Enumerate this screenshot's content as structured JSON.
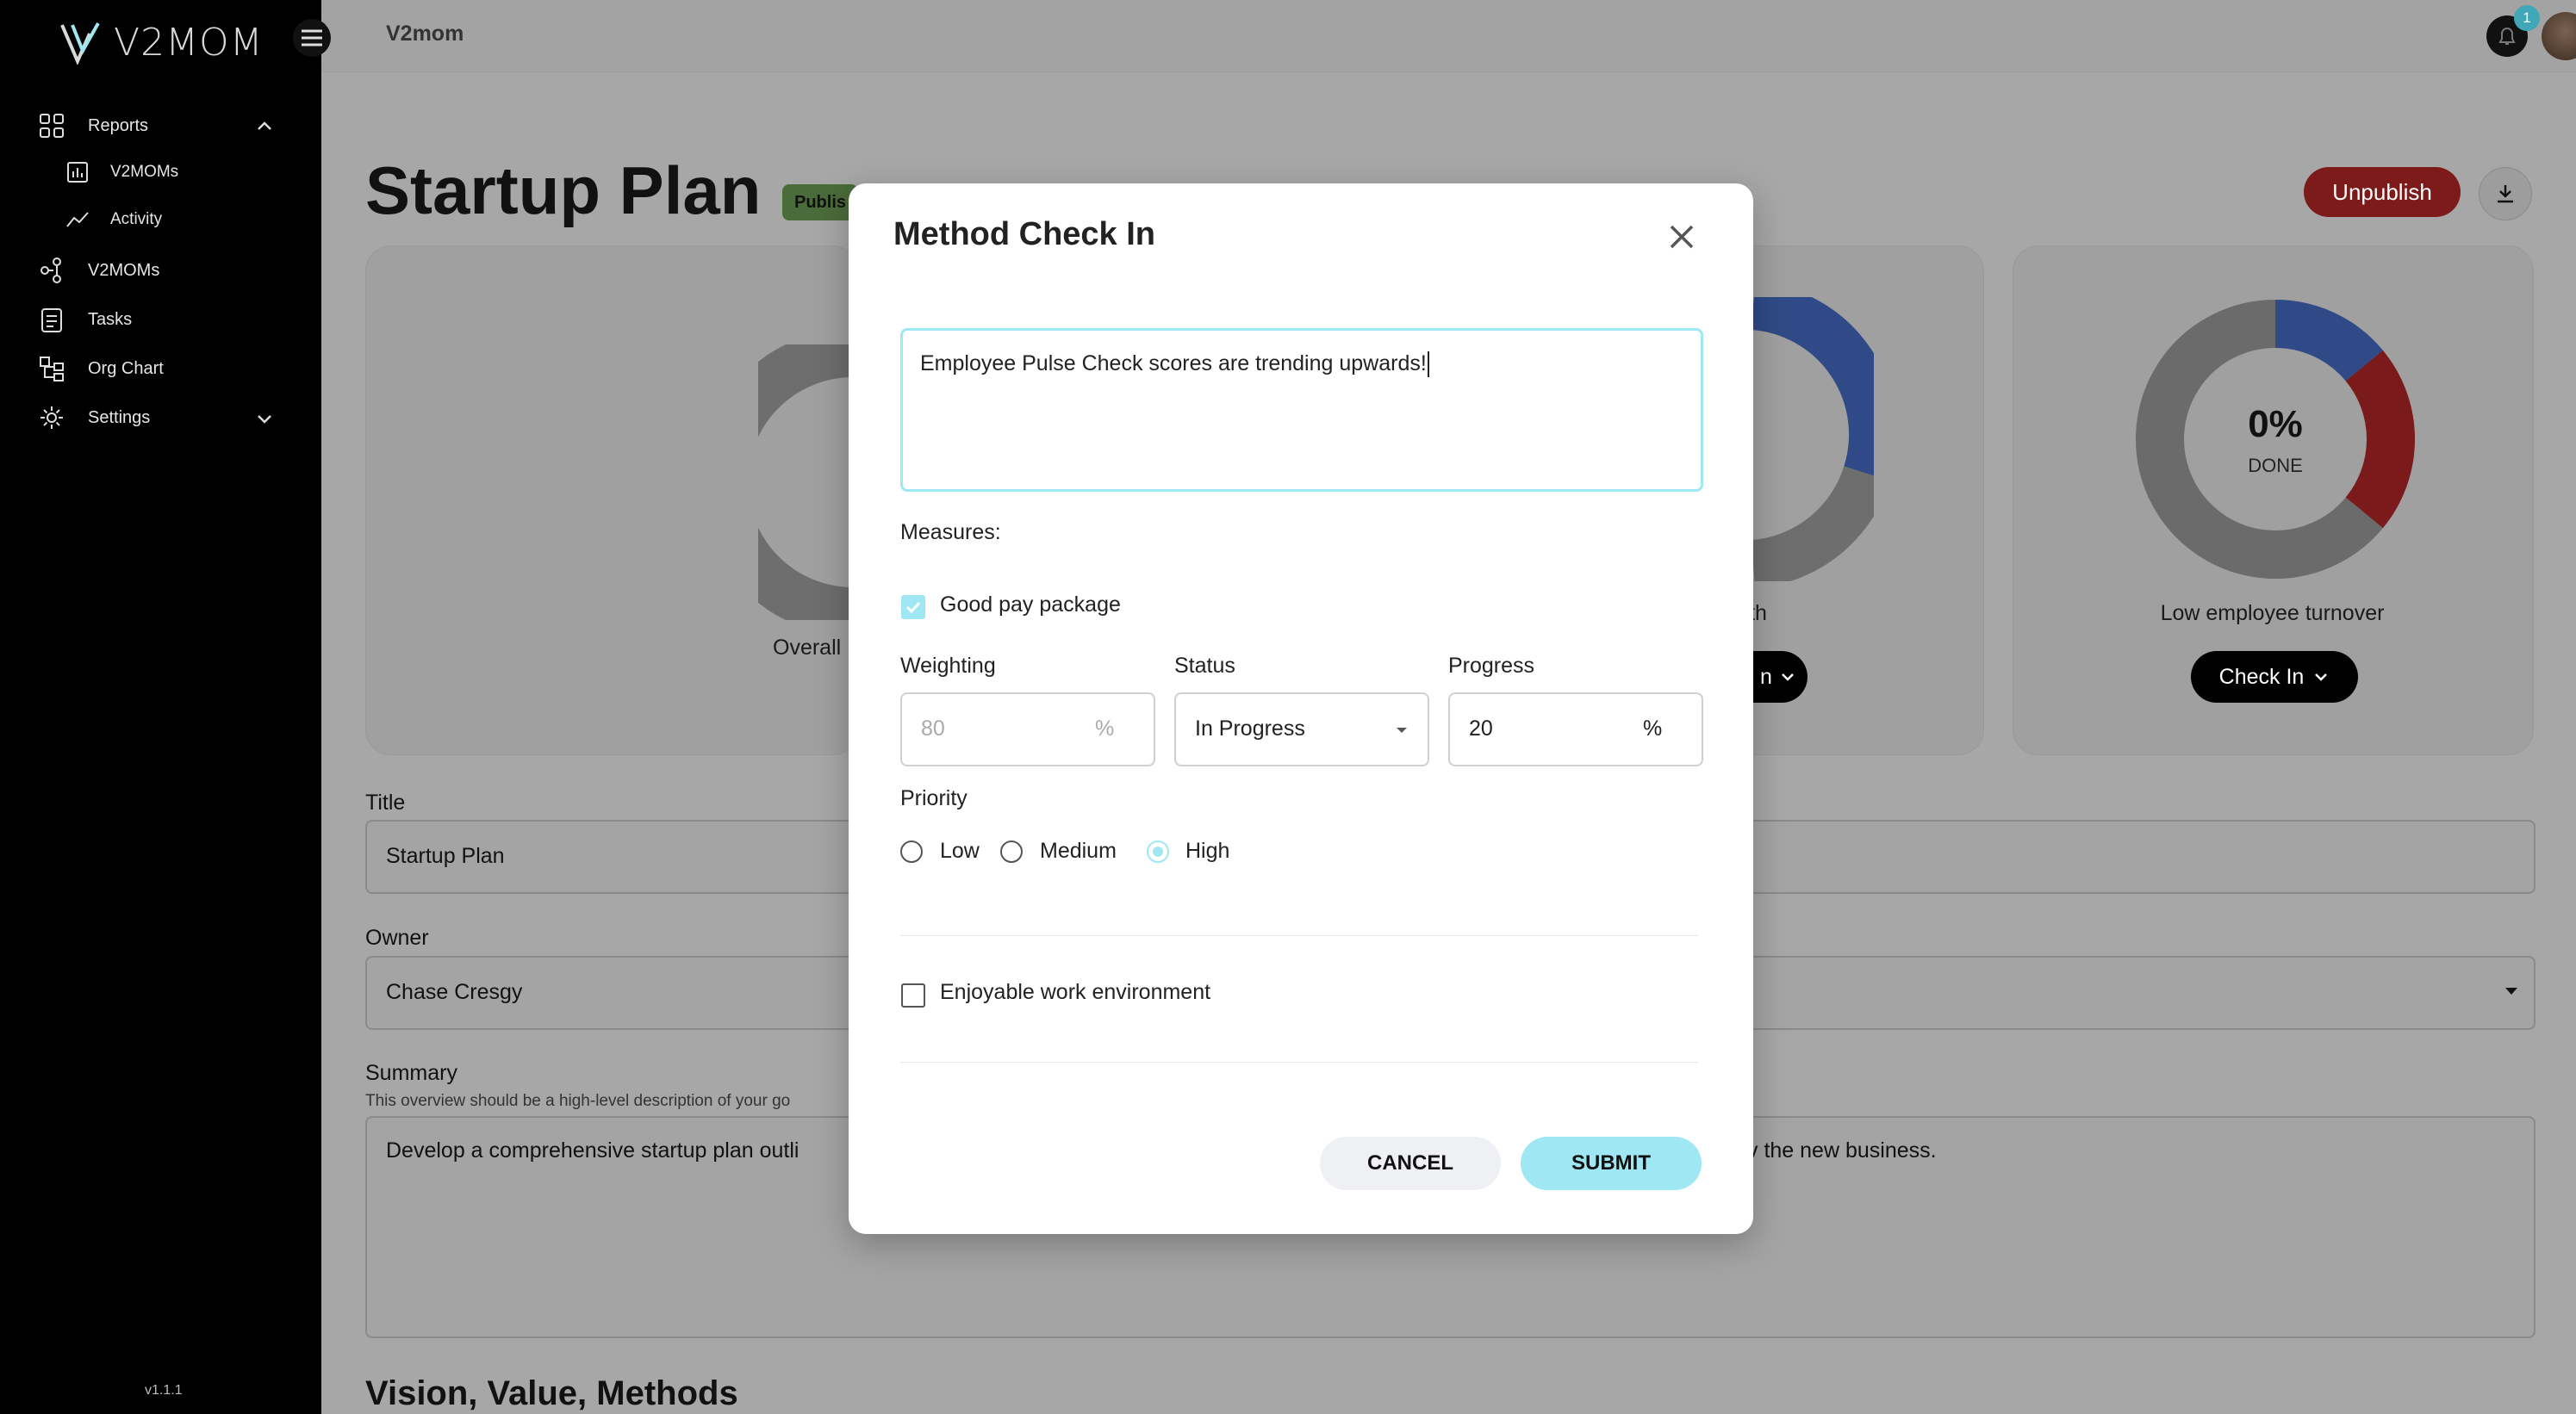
{
  "app": {
    "logo_text": "V2MOM",
    "version": "v1.1.1"
  },
  "sidebar": {
    "items": [
      {
        "label": "Reports",
        "icon": "grid-icon"
      },
      {
        "label": "V2MOMs",
        "icon": "bar-chart-icon"
      },
      {
        "label": "Activity",
        "icon": "trend-line-icon"
      },
      {
        "label": "V2MOMs",
        "icon": "hierarchy-icon"
      },
      {
        "label": "Tasks",
        "icon": "clipboard-icon"
      },
      {
        "label": "Org Chart",
        "icon": "org-chart-icon"
      },
      {
        "label": "Settings",
        "icon": "gear-icon"
      }
    ]
  },
  "topbar": {
    "breadcrumb": "V2mom",
    "notification_count": "1"
  },
  "page": {
    "title": "Startup Plan",
    "status_badge": "Publis",
    "unpublish_label": "Unpublish",
    "gauges": [
      {
        "label": "Overall",
        "done_text": "",
        "segments": []
      },
      {
        "label": "wth",
        "done_text": "",
        "button": "n"
      },
      {
        "label": "Low employee turnover",
        "percent": "0%",
        "done_text": "DONE",
        "button": "Check In",
        "segments": [
          {
            "color": "#2f4a86",
            "fraction": 0.14
          },
          {
            "color": "#7a1a1a",
            "fraction": 0.22
          },
          {
            "color": "#6b6b6b",
            "fraction": 0.64
          }
        ]
      }
    ],
    "fields": {
      "title_label": "Title",
      "title_value": "Startup Plan",
      "owner_label": "Owner",
      "owner_value": "Chase Cresgy",
      "summary_label": "Summary",
      "summary_help": "This overview should be a high-level description of your go",
      "summary_value": "Develop a comprehensive startup plan outli",
      "summary_value_end": "v the new business."
    },
    "section_heading": "Vision, Value, Methods"
  },
  "modal": {
    "title": "Method Check In",
    "message": "Employee Pulse Check scores are trending upwards!",
    "measures_label": "Measures:",
    "measure_1": {
      "label": "Good pay package",
      "checked": true
    },
    "weighting_label": "Weighting",
    "weighting_value": "80",
    "weighting_unit": "%",
    "status_label": "Status",
    "status_value": "In Progress",
    "progress_label": "Progress",
    "progress_value": "20",
    "progress_unit": "%",
    "priority_label": "Priority",
    "priority_options": [
      "Low",
      "Medium",
      "High"
    ],
    "priority_selected": "High",
    "measure_2": {
      "label": "Enjoyable work environment",
      "checked": false
    },
    "cancel_label": "CANCEL",
    "submit_label": "SUBMIT"
  }
}
